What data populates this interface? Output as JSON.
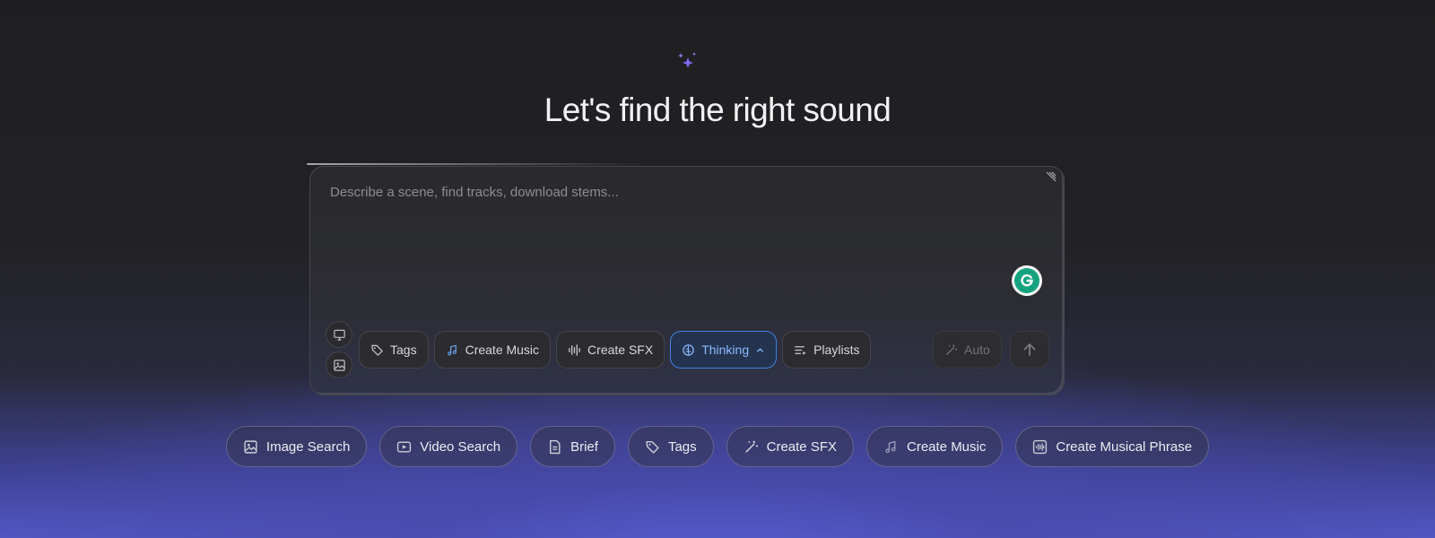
{
  "heading": "Let's find the right sound",
  "composer": {
    "placeholder": "Describe a scene, find tracks, download stems...",
    "value": "",
    "grammarly_icon": "grammarly-icon",
    "tools": [
      {
        "label": "Tags",
        "icon": "tag-icon",
        "active": false
      },
      {
        "label": "Create Music",
        "icon": "music-note-icon",
        "active": false
      },
      {
        "label": "Create SFX",
        "icon": "waveform-icon",
        "active": false
      },
      {
        "label": "Thinking",
        "icon": "brain-icon",
        "active": true
      },
      {
        "label": "Playlists",
        "icon": "playlist-icon",
        "active": false
      }
    ],
    "auto_label": "Auto"
  },
  "suggestions": [
    {
      "label": "Image Search",
      "icon": "image-icon"
    },
    {
      "label": "Video Search",
      "icon": "video-icon"
    },
    {
      "label": "Brief",
      "icon": "document-icon"
    },
    {
      "label": "Tags",
      "icon": "tag-icon"
    },
    {
      "label": "Create SFX",
      "icon": "magic-wand-icon"
    },
    {
      "label": "Create Music",
      "icon": "music-note-icon"
    },
    {
      "label": "Create Musical Phrase",
      "icon": "waveform-box-icon"
    }
  ],
  "colors": {
    "accent": "#3f82e0",
    "accent_text": "#8dbbff",
    "sparkle": "#7b6cf0",
    "background": "#1f1f21",
    "glow": "#5158c4"
  }
}
